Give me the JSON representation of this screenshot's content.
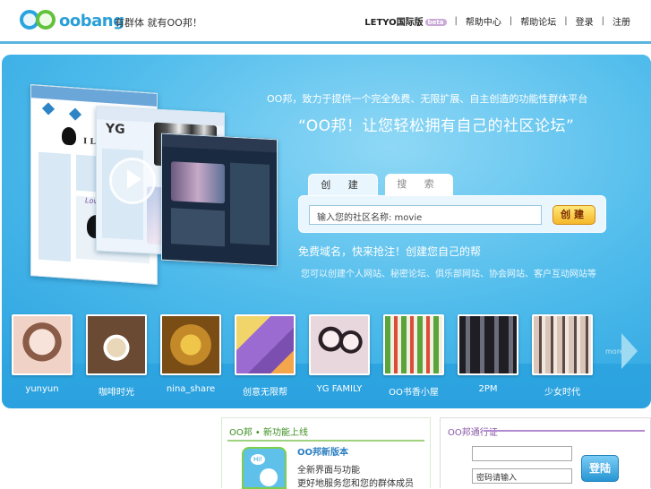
{
  "header": {
    "logo_text": "oobang",
    "slogan": "有群体 就有OO邦！",
    "nav": [
      {
        "label": "LETYO国际版",
        "badge": "beta"
      },
      {
        "label": "帮助中心"
      },
      {
        "label": "帮助论坛"
      },
      {
        "label": "登录"
      },
      {
        "label": "注册"
      }
    ]
  },
  "hero": {
    "tagline": "OO邦，致力于提供一个完全免费、无限扩展、自主创造的功能性群体平台",
    "quote": "“OO邦！让您轻松拥有自己的社区论坛”",
    "tabs": [
      {
        "label": "创 建"
      },
      {
        "label": "搜 索"
      }
    ],
    "search_value": "输入您的社区名称: movie",
    "create_button": "创建",
    "promo_title": "免费域名，快来抢注！创建您自己的帮",
    "promo_sub": "您可以创建个人网站、秘密论坛、俱乐部网站、协会网站、客户互动网站等",
    "screenshot_text": {
      "love_cats": "I Love Cats",
      "yg": "YG",
      "lovely": "Lovely Life"
    }
  },
  "featured": {
    "items": [
      {
        "caption": "yunyun",
        "color": "#f1d2c6",
        "accent": "#8a5b46"
      },
      {
        "caption": "咖啡时光",
        "color": "#6b4a33",
        "accent": "#e8d7b9"
      },
      {
        "caption": "nina_share",
        "color": "#a8741d",
        "accent": "#f0c64a"
      },
      {
        "caption": "创意无限帮",
        "color": "#7b4fb0",
        "accent": "#f1d46a"
      },
      {
        "caption": "YG FAMILY",
        "color": "#e8d7dd",
        "accent": "#7d5a6d"
      },
      {
        "caption": "OO书香小屋",
        "color": "#5aa53b",
        "accent": "#d94d39"
      },
      {
        "caption": "2PM",
        "color": "#1e1e24",
        "accent": "#6c6d7a"
      },
      {
        "caption": "少女时代",
        "color": "#d9c6b8",
        "accent": "#5b4a48"
      }
    ],
    "more_label": "more"
  },
  "news": {
    "title": "OO邦 • 新功能上线",
    "icon_text": "Hi!",
    "item_title": "OO邦新版本",
    "line1": "全新界面与功能",
    "line2": "更好地服务您和您的群体成员"
  },
  "login": {
    "title": "OO邦通行证",
    "password_placeholder": "密码请输入",
    "submit": "登陆"
  },
  "colors": {
    "brand_blue": "#2aa4dd",
    "brand_green": "#62c23b",
    "hero_bg": "#36afe6",
    "create_button": "#f5b62a"
  }
}
